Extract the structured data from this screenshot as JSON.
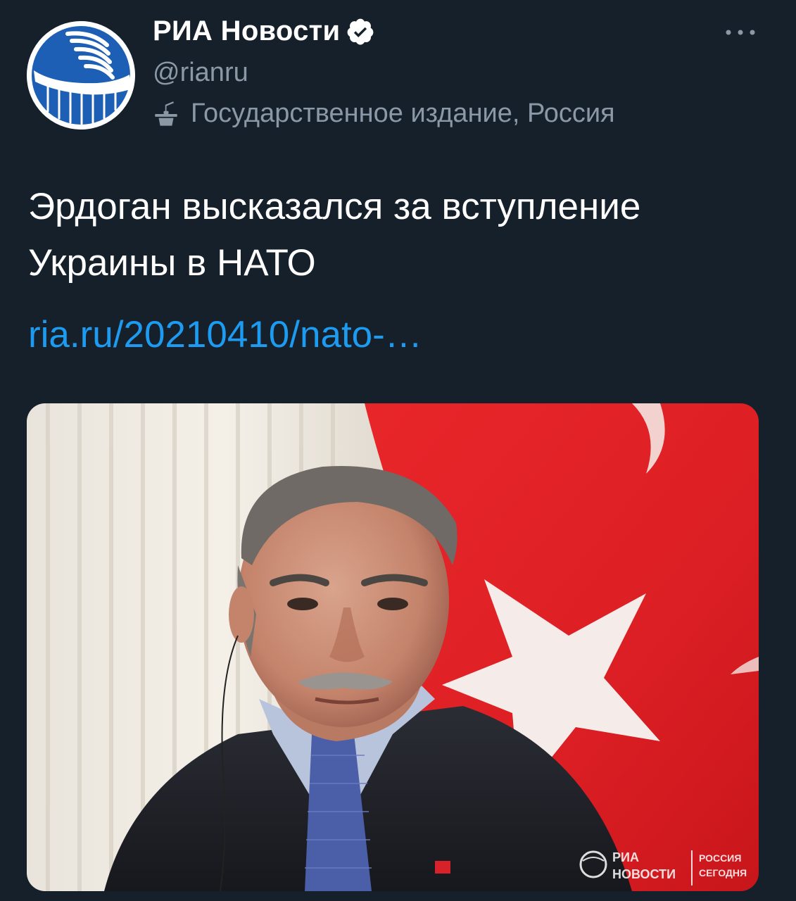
{
  "account": {
    "display_name": "РИА Новости",
    "handle": "@rianru",
    "label": "Государственное издание, Россия",
    "avatar_icon": "ria-novosti-logo-icon",
    "verified_icon": "verified-badge-icon"
  },
  "tweet": {
    "text_line_1": "Эрдоган высказался за вступление",
    "text_line_2": "Украины в НАТО",
    "link_text": "ria.ru/20210410/nato-…"
  },
  "media": {
    "description_icon": "photo-erdogan-icon",
    "watermark_left_1": "РИА",
    "watermark_left_2": "НОВОСТИ",
    "watermark_right_1": "РОССИЯ",
    "watermark_right_2": "СЕГОДНЯ"
  },
  "colors": {
    "background": "#15202b",
    "text_primary": "#ffffff",
    "text_secondary": "#8b98a5",
    "link": "#1d9bf0",
    "brand_blue": "#1f5fb0"
  }
}
